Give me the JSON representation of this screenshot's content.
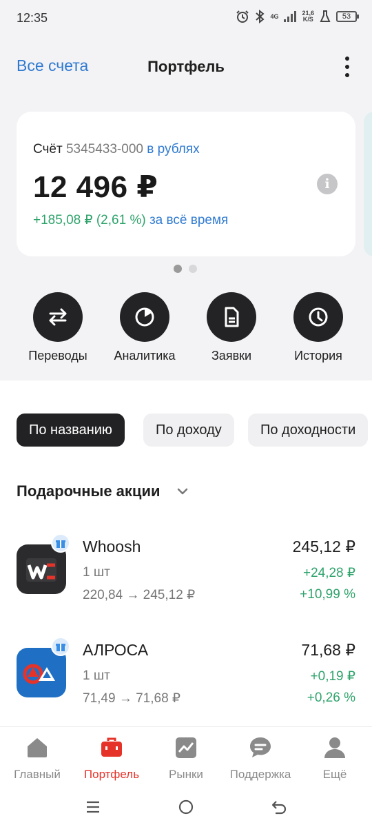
{
  "status_bar": {
    "time": "12:35",
    "network": "4G",
    "speed_value": "21,6",
    "speed_unit": "K/S",
    "battery": "53",
    "icons": [
      "alarm-icon",
      "bluetooth-icon",
      "signal-icon",
      "flask-icon",
      "battery-icon"
    ]
  },
  "header": {
    "all_accounts": "Все счета",
    "title": "Портфель",
    "more_icon": "more-vertical-icon"
  },
  "account": {
    "label": "Счёт",
    "number": "5345433-000",
    "currency": "в рублях",
    "balance": "12 496 ₽",
    "profit": "+185,08 ₽ (2,61 %)",
    "profit_period": "за всё время",
    "info_icon": "info-icon",
    "carousel_pages": 2,
    "carousel_active": 1
  },
  "actions": [
    {
      "label": "Переводы",
      "icon": "transfer-icon"
    },
    {
      "label": "Аналитика",
      "icon": "analytics-icon"
    },
    {
      "label": "Заявки",
      "icon": "document-icon"
    },
    {
      "label": "История",
      "icon": "clock-icon"
    }
  ],
  "sort": {
    "options": [
      "По названию",
      "По доходу",
      "По доходности"
    ],
    "active_index": 0
  },
  "section": {
    "title": "Подарочные акции",
    "chevron_icon": "chevron-down-icon"
  },
  "stocks": [
    {
      "name": "Whoosh",
      "qty": "1 шт",
      "range": "220,84 → 245,12 ₽",
      "price": "245,12 ₽",
      "change": "+24,28 ₽",
      "pct": "+10,99 %",
      "logo_color": "#2b2b2d",
      "badge_icon": "gift-icon"
    },
    {
      "name": "АЛРОСА",
      "qty": "1 шт",
      "range": "71,49 → 71,68 ₽",
      "price": "71,68 ₽",
      "change": "+0,19 ₽",
      "pct": "+0,26 %",
      "logo_color": "#1f6fc4",
      "badge_icon": "gift-icon"
    }
  ],
  "bottom_nav": [
    {
      "label": "Главный",
      "icon": "home-icon"
    },
    {
      "label": "Портфель",
      "icon": "briefcase-icon"
    },
    {
      "label": "Рынки",
      "icon": "chart-icon"
    },
    {
      "label": "Поддержка",
      "icon": "chat-icon"
    },
    {
      "label": "Ещё",
      "icon": "user-icon"
    }
  ],
  "bottom_nav_active": 1,
  "colors": {
    "accent_blue": "#2f7ad1",
    "positive_green": "#2ea36b",
    "active_red": "#e6332a",
    "dark": "#232325"
  }
}
